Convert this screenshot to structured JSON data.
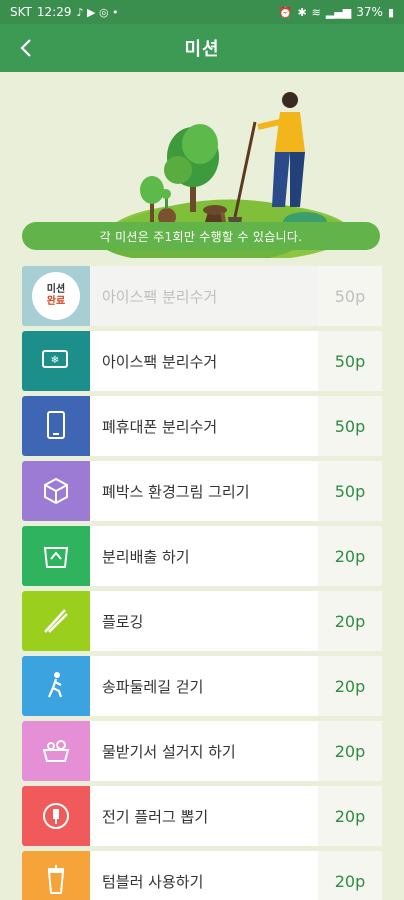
{
  "status_bar": {
    "carrier": "SKT",
    "time": "12:29",
    "battery": "37%"
  },
  "header": {
    "title": "미션"
  },
  "notice": "각 미션은 주1회만 수행할 수 있습니다.",
  "missions": [
    {
      "label": "아이스팩 분리수거",
      "points": "50p",
      "color": "#a7cfd3",
      "icon": "completed-stamp-icon",
      "done": true,
      "stamp_line1": "미션",
      "stamp_line2": "완료"
    },
    {
      "label": "아이스팩 분리수거",
      "points": "50p",
      "color": "#1c8f8a",
      "icon": "ice-pack-icon",
      "done": false
    },
    {
      "label": "폐휴대폰 분리수거",
      "points": "50p",
      "color": "#3f66b5",
      "icon": "phone-icon",
      "done": false
    },
    {
      "label": "폐박스 환경그림 그리기",
      "points": "50p",
      "color": "#9b7bd3",
      "icon": "box-icon",
      "done": false
    },
    {
      "label": "분리배출 하기",
      "points": "20p",
      "color": "#2fb35e",
      "icon": "recycle-bin-icon",
      "done": false
    },
    {
      "label": "플로깅",
      "points": "20p",
      "color": "#9bcf1d",
      "icon": "tongs-icon",
      "done": false
    },
    {
      "label": "송파둘레길 걷기",
      "points": "20p",
      "color": "#3aa3e0",
      "icon": "walking-person-icon",
      "done": false
    },
    {
      "label": "물받기서 설거지 하기",
      "points": "20p",
      "color": "#e58fd6",
      "icon": "dish-basin-icon",
      "done": false
    },
    {
      "label": "전기 플러그 뽑기",
      "points": "20p",
      "color": "#f05a5a",
      "icon": "plug-icon",
      "done": false
    },
    {
      "label": "텀블러 사용하기",
      "points": "20p",
      "color": "#f6a33a",
      "icon": "tumbler-icon",
      "done": false
    }
  ]
}
